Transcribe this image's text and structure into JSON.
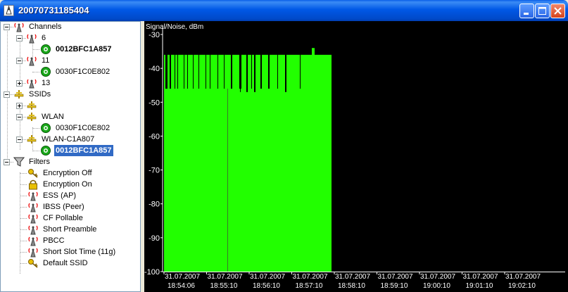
{
  "window": {
    "title": "20070731185404",
    "minimize_label": "minimize",
    "maximize_label": "maximize",
    "close_label": "close"
  },
  "tree": {
    "channels": {
      "label": "Channels",
      "items": [
        {
          "label": "6",
          "children": [
            "0012BFC1A857"
          ]
        },
        {
          "label": "11",
          "children": [
            "0030F1C0E802"
          ]
        },
        {
          "label": "13"
        }
      ]
    },
    "ssids": {
      "label": "SSIDs",
      "items": [
        {
          "label": ""
        },
        {
          "label": "WLAN",
          "children": [
            "0030F1C0E802"
          ]
        },
        {
          "label": "WLAN-C1A807",
          "children": [
            "0012BFC1A857"
          ]
        }
      ]
    },
    "filters": {
      "label": "Filters",
      "items": [
        "Encryption Off",
        "Encryption On",
        "ESS (AP)",
        "IBSS (Peer)",
        "CF Pollable",
        "Short Preamble",
        "PBCC",
        "Short Slot Time (11g)",
        "Default SSID"
      ]
    }
  },
  "chart_data": {
    "type": "bar",
    "ylabel": "Signal/Noise, dBm",
    "ylim": [
      -100,
      -30
    ],
    "yticks": [
      -30,
      -40,
      -50,
      -60,
      -70,
      -80,
      -90,
      -100
    ],
    "xticks": [
      {
        "date": "31.07.2007",
        "time": "18:54:06"
      },
      {
        "date": "31.07.2007",
        "time": "18:55:10"
      },
      {
        "date": "31.07.2007",
        "time": "18:56:10"
      },
      {
        "date": "31.07.2007",
        "time": "18:57:10"
      },
      {
        "date": "31.07.2007",
        "time": "18:58:10"
      },
      {
        "date": "31.07.2007",
        "time": "18:59:10"
      },
      {
        "date": "31.07.2007",
        "time": "19:00:10"
      },
      {
        "date": "31.07.2007",
        "time": "19:01:10"
      },
      {
        "date": "31.07.2007",
        "time": "19:02:10"
      }
    ],
    "bar_color": "#22FF00",
    "grid": false,
    "signal_levels": [
      -36,
      -36,
      -46,
      -46,
      -46,
      -36,
      -36,
      -36,
      -46,
      -46,
      -36,
      -36,
      -36,
      -36,
      -36,
      -46,
      -36,
      -36,
      -36,
      -46,
      -36,
      -36,
      -36,
      -36,
      -36,
      -36,
      -36,
      -36,
      -46,
      -36,
      -36,
      -36,
      -36,
      -46,
      -36,
      -36,
      -36,
      -36,
      -36,
      -36,
      -36,
      -46,
      -36,
      -36,
      -36,
      -36,
      -36,
      -36,
      -36,
      -46,
      -36,
      -36,
      -36,
      -36,
      -36,
      -36,
      -36,
      -36,
      -36,
      -46,
      -36,
      -36,
      -36,
      -36,
      -36,
      -46,
      -36,
      -36,
      -36,
      -36,
      -36,
      -36,
      -36,
      -36,
      -36,
      -36,
      -46,
      -36,
      -36,
      -36,
      -36,
      -36,
      -36,
      -36,
      -36,
      -46,
      -36,
      -36,
      -36,
      -36,
      -36,
      -36,
      -36,
      -36,
      -36,
      -46,
      -46,
      -36,
      -36,
      -36,
      -36,
      -36,
      -36,
      -36,
      -36,
      -36,
      -36,
      -46,
      -47,
      -46,
      -36,
      -36,
      -36,
      -36,
      -36,
      -36,
      -36,
      -47,
      -47,
      -36,
      -36,
      -36,
      -36,
      -36,
      -46,
      -36,
      -36,
      -36,
      -47,
      -47,
      -36,
      -36,
      -36,
      -36,
      -36,
      -36,
      -36,
      -46,
      -46,
      -36,
      -36,
      -36,
      -36,
      -36,
      -36,
      -36,
      -36,
      -36,
      -46,
      -46,
      -36,
      -36,
      -36,
      -36,
      -36,
      -36,
      -36,
      -36,
      -36,
      -36,
      -36,
      -46,
      -36,
      -36,
      -36,
      -36,
      -36,
      -36,
      -36,
      -36,
      -36,
      -36,
      -47,
      -47,
      -36,
      -36,
      -36,
      -36,
      -36,
      -36,
      -36,
      -36,
      -36,
      -36,
      -36,
      -36,
      -36,
      -36,
      -36,
      -36,
      -36,
      -36,
      -36,
      -46,
      -36,
      -36,
      -36,
      -36,
      -36,
      -36,
      -36,
      -36,
      -36,
      -36,
      -36,
      -36,
      -36,
      -36,
      -36,
      -36,
      -34,
      -34,
      -34,
      -34,
      -36,
      -36,
      -36,
      -36,
      -36,
      -36,
      -36,
      -36,
      -36,
      -36,
      -36,
      -36,
      -36,
      -36,
      -36,
      -36,
      -36,
      -36,
      -36,
      -36,
      -36,
      -36,
      -36,
      -36
    ]
  }
}
